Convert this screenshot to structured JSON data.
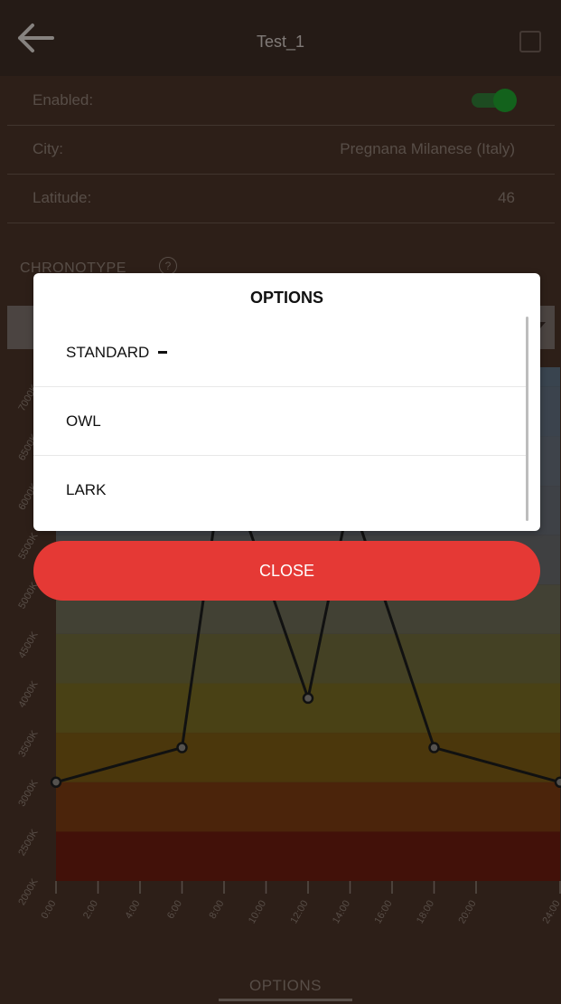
{
  "header": {
    "title": "Test_1"
  },
  "settings": [
    {
      "label": "Enabled:",
      "value": ""
    },
    {
      "label": "City:",
      "value": "Pregnana Milanese (Italy)"
    },
    {
      "label": "Latitude:",
      "value": "46"
    }
  ],
  "colors": {
    "accent_red": "#e53935",
    "toggle_on": "#1f9e2e"
  },
  "section": {
    "title": "CHRONOTYPE",
    "help": "?"
  },
  "chart_data": {
    "type": "line",
    "x": [
      "0:00",
      "2:00",
      "4:00",
      "6:00",
      "8:00",
      "10:00",
      "12:00",
      "14:00",
      "16:00",
      "18:00",
      "20:00",
      "24:00"
    ],
    "y_ticks": [
      "2000K",
      "2500K",
      "3000K",
      "3500K",
      "4000K",
      "4500K",
      "5000K",
      "5500K",
      "6000K",
      "6500K",
      "7000K"
    ],
    "series": [
      {
        "points": [
          {
            "x": "0:00",
            "y": 3000
          },
          {
            "x": "6:00",
            "y": 3350
          },
          {
            "x": "8:00",
            "y": 6300
          },
          {
            "x": "12:00",
            "y": 3850
          },
          {
            "x": "14:00",
            "y": 5900
          },
          {
            "x": "18:00",
            "y": 3350
          },
          {
            "x": "24:00",
            "y": 3000
          }
        ]
      }
    ],
    "ylim": [
      2000,
      7200
    ]
  },
  "dialog": {
    "title": "OPTIONS",
    "options": [
      {
        "label": "STANDARD",
        "selected": true
      },
      {
        "label": "OWL",
        "selected": false
      },
      {
        "label": "LARK",
        "selected": false
      }
    ],
    "close_label": "CLOSE"
  },
  "bottom_nav": {
    "label": "OPTIONS"
  }
}
